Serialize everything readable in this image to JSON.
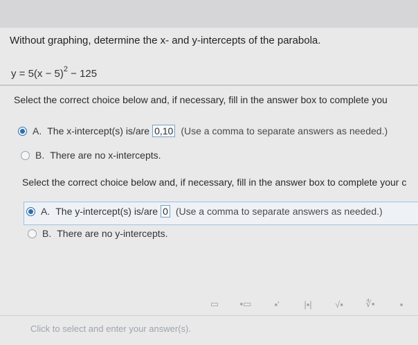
{
  "question": "Without graphing, determine the x- and y-intercepts of the parabola.",
  "equation": {
    "main": "y = 5(x − 5)",
    "exp": "2",
    "tail": " − 125"
  },
  "part1": {
    "instruction": "Select the correct choice below and, if necessary, fill in the answer box to complete you",
    "choiceA": {
      "letter": "A.",
      "text": "The x-intercept(s) is/are",
      "answer": "0,10",
      "hint": "(Use a comma to separate answers as needed.)",
      "selected": true
    },
    "choiceB": {
      "letter": "B.",
      "text": "There are no x-intercepts.",
      "selected": false
    }
  },
  "part2": {
    "instruction": "Select the correct choice below and, if necessary, fill in the answer box to complete your c",
    "choiceA": {
      "letter": "A.",
      "text": "The y-intercept(s) is/are",
      "answer": "0",
      "hint": "(Use a comma to separate answers as needed.)",
      "selected": true
    },
    "choiceB": {
      "letter": "B.",
      "text": "There are no y-intercepts.",
      "selected": false
    }
  },
  "toolbar": {
    "icons": [
      "fraction-icon",
      "mixed-number-icon",
      "exponent-icon",
      "absolute-value-icon",
      "square-root-icon",
      "nth-root-icon",
      "more-icon"
    ],
    "glyphs": [
      "▭",
      "▪▭",
      "▪'",
      "|▪|",
      "√▪",
      "∜▪",
      "▪"
    ]
  },
  "footer": "Click to select and enter your answer(s)."
}
